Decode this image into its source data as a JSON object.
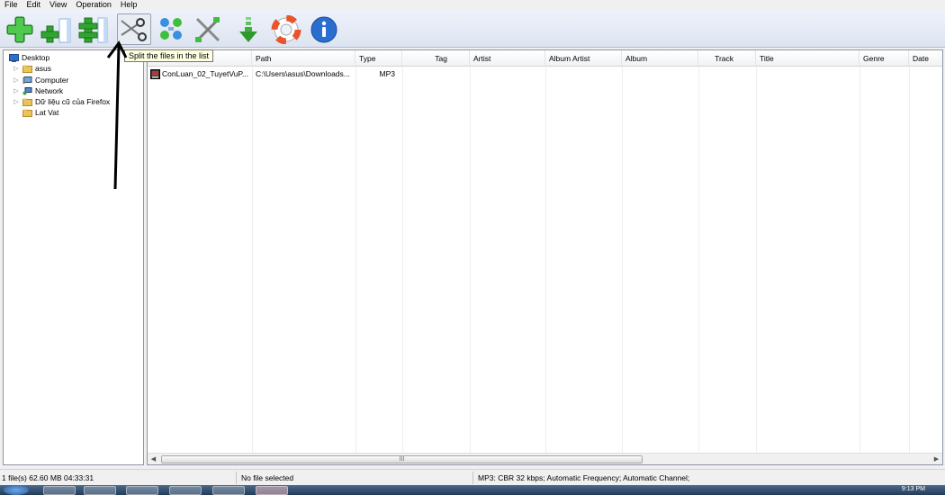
{
  "menu": [
    "File",
    "Edit",
    "View",
    "Operation",
    "Help"
  ],
  "toolbar": {
    "tooltip": "Split the files in the list"
  },
  "tree": {
    "items": [
      {
        "label": "Desktop",
        "icon": "desktop-icon"
      },
      {
        "label": "asus",
        "icon": "folder-icon"
      },
      {
        "label": "Computer",
        "icon": "computer-icon"
      },
      {
        "label": "Network",
        "icon": "network-icon"
      },
      {
        "label": "Dữ liệu cũ của Firefox",
        "icon": "folder-icon"
      },
      {
        "label": "Lat Vat",
        "icon": "folder-icon"
      }
    ]
  },
  "list": {
    "columns": [
      "Path",
      "Type",
      "Tag",
      "Artist",
      "Album Artist",
      "Album",
      "Track",
      "Title",
      "Genre",
      "Date"
    ],
    "rows": [
      {
        "name": "ConLuan_02_TuyetVuP...",
        "path": "C:\\Users\\asus\\Downloads...",
        "type": "MP3"
      }
    ],
    "scroll_grip": "III"
  },
  "status": {
    "summary": "1 file(s)  62.60 MB  04:33:31",
    "selection": "No file selected",
    "format": "MP3:  CBR  32 kbps; Automatic Frequency; Automatic Channel;"
  },
  "taskbar": {
    "clock": "9:13 PM"
  }
}
